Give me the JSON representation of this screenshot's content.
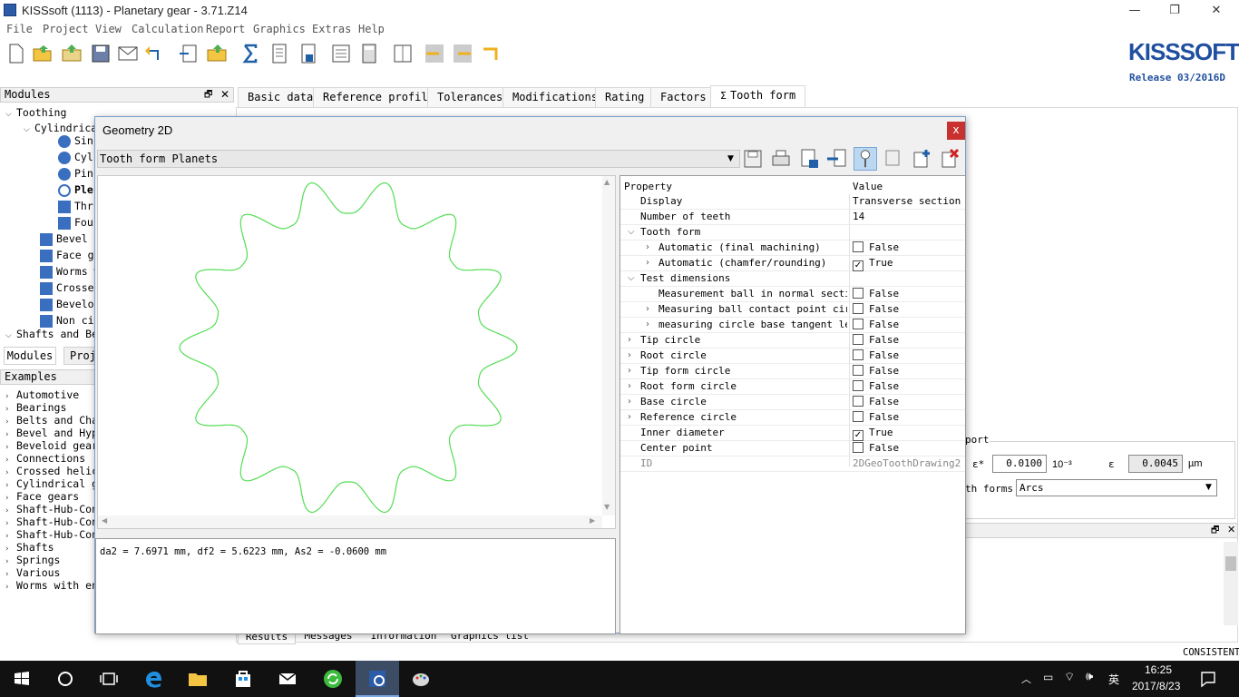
{
  "window": {
    "title": "KISSsoft (1113) - Planetary gear - 3.71.Z14"
  },
  "menu": [
    "File",
    "Project",
    "View",
    "Calculation",
    "Report",
    "Graphics",
    "Extras",
    "Help"
  ],
  "logo": {
    "text": "KISSSOFT",
    "release": "Release 03/2016D"
  },
  "modules_panel": {
    "title": "Modules",
    "items": [
      "Toothing",
      "Cylindrica",
      "Sin",
      "Cyl",
      "Pin",
      "Ple",
      "Thr",
      "Fou",
      "Bevel a",
      "Face ge",
      "Worms w",
      "Crossed",
      "Beveloi",
      "Non cir",
      "Shafts and Bea"
    ],
    "tabs": [
      "Modules",
      "Proj"
    ]
  },
  "examples_panel": {
    "title": "Examples",
    "items": [
      "Automotive",
      "Bearings",
      "Belts and Cha",
      "Bevel and Hypo",
      "Beveloid gear",
      "Connections",
      "Crossed helic",
      "Cylindrical ge",
      "Face gears",
      "Shaft-Hub-Con",
      "Shaft-Hub-Con",
      "Shaft-Hub-Con",
      "Shafts",
      "Springs",
      "Various",
      "Worms with env"
    ]
  },
  "tabs": [
    "Basic data",
    "Reference profile",
    "Tolerances",
    "Modifications",
    "Rating",
    "Factors",
    "Tooth form"
  ],
  "active_tab": "Tooth form",
  "dialog": {
    "title": "Geometry 2D",
    "close_label": "x",
    "combo_value": "Tooth form Planets",
    "status_text": "da2 = 7.6971 mm, df2 = 5.6223 mm, As2 = -0.0600 mm",
    "gear": {
      "teeth": 14,
      "color": "#55dd55"
    },
    "props_header": {
      "name": "Property",
      "value": "Value"
    },
    "properties": [
      {
        "name": "Display",
        "value": "Transverse section",
        "indent": 1
      },
      {
        "name": "Number of teeth",
        "value": "14",
        "indent": 1
      },
      {
        "name": "Tooth form",
        "value": "",
        "indent": 0,
        "chev": "down"
      },
      {
        "name": "Automatic (final machining)",
        "value": "False",
        "checked": false,
        "indent": 2,
        "chev": "right"
      },
      {
        "name": "Automatic (chamfer/rounding)",
        "value": "True",
        "checked": true,
        "indent": 2,
        "chev": "right"
      },
      {
        "name": "Test dimensions",
        "value": "",
        "indent": 0,
        "chev": "down"
      },
      {
        "name": "Measurement ball in normal section",
        "value": "False",
        "checked": false,
        "indent": 2
      },
      {
        "name": "Measuring ball contact point cir…",
        "value": "False",
        "checked": false,
        "indent": 2,
        "chev": "right"
      },
      {
        "name": "measuring circle base tangent le…",
        "value": "False",
        "checked": false,
        "indent": 2,
        "chev": "right"
      },
      {
        "name": "Tip circle",
        "value": "False",
        "checked": false,
        "indent": 0,
        "chev": "right"
      },
      {
        "name": "Root circle",
        "value": "False",
        "checked": false,
        "indent": 0,
        "chev": "right"
      },
      {
        "name": "Tip form circle",
        "value": "False",
        "checked": false,
        "indent": 0,
        "chev": "right"
      },
      {
        "name": "Root form circle",
        "value": "False",
        "checked": false,
        "indent": 0,
        "chev": "right"
      },
      {
        "name": "Base circle",
        "value": "False",
        "checked": false,
        "indent": 0,
        "chev": "right"
      },
      {
        "name": "Reference circle",
        "value": "False",
        "checked": false,
        "indent": 0,
        "chev": "right"
      },
      {
        "name": "Inner diameter",
        "value": "True",
        "checked": true,
        "indent": 1
      },
      {
        "name": "Center point",
        "value": "False",
        "checked": false,
        "indent": 1
      },
      {
        "name": "ID",
        "value": "2DGeoToothDrawing2",
        "indent": 1,
        "readonly": true
      }
    ]
  },
  "right_behind": {
    "group_label": "port",
    "field1_label": "ε*",
    "field1_value": "0.0100",
    "field1_unit": "10⁻³",
    "field2_label": "ε",
    "field2_value": "0.0045",
    "field2_unit": "µm",
    "tooth_forms_label": "th forms",
    "tooth_forms_value": "Arcs"
  },
  "bottom_tabs": [
    "Results",
    "Messages",
    "Information",
    "Graphics list"
  ],
  "status_right": "CONSISTENT",
  "taskbar": {
    "time": "16:25",
    "date": "2017/8/23",
    "lang": "英"
  }
}
